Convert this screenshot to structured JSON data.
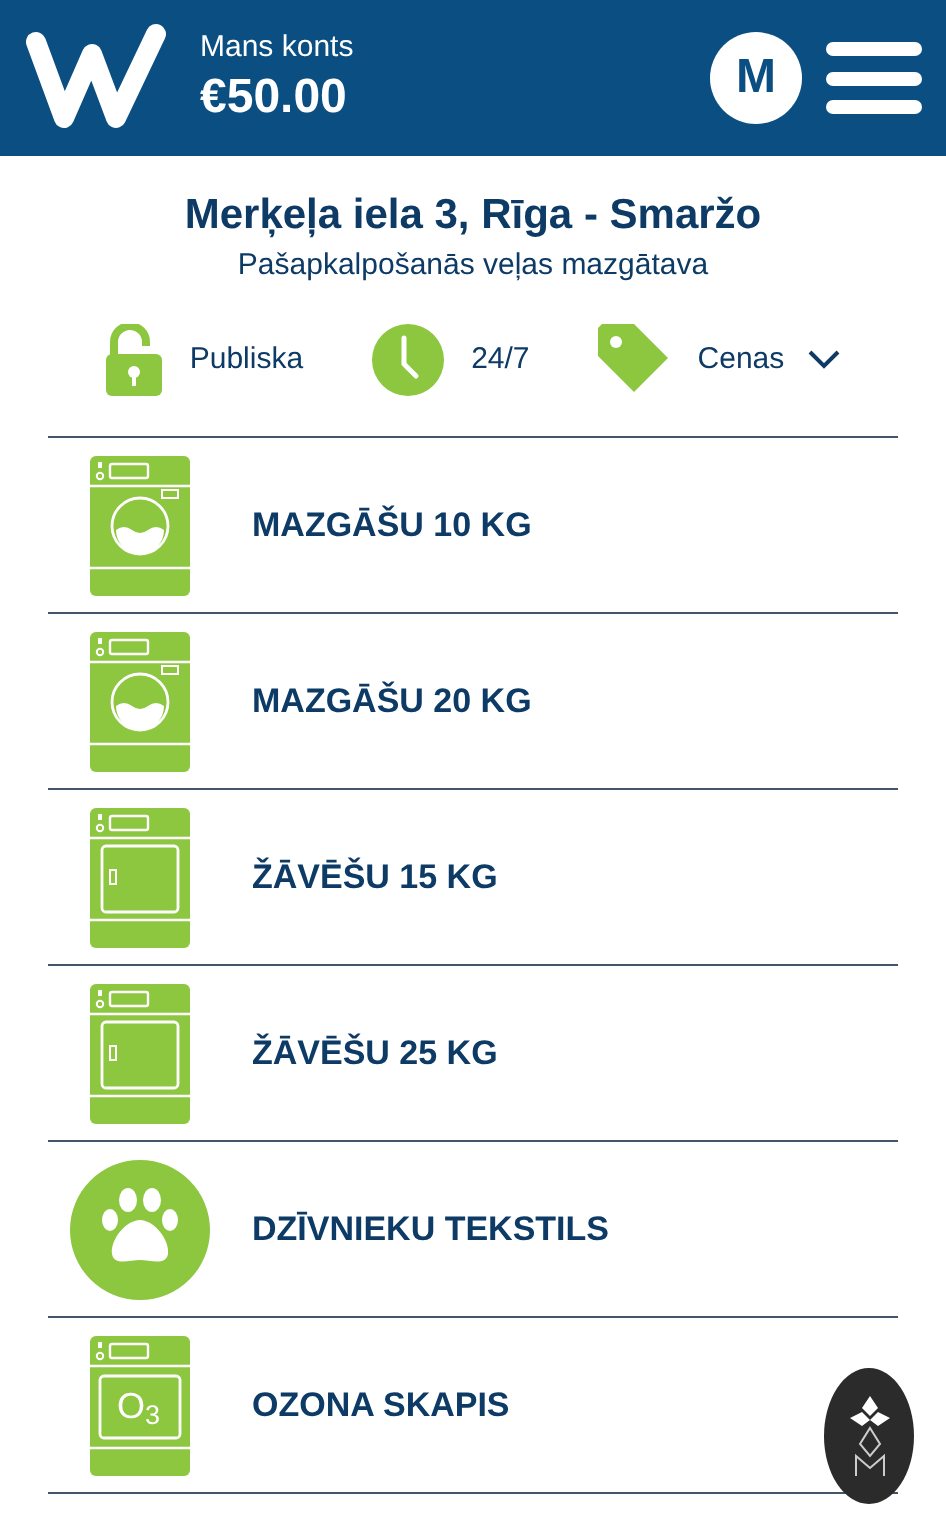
{
  "header": {
    "account_label": "Mans konts",
    "balance": "€50.00",
    "avatar_letter": "M"
  },
  "location": {
    "title": "Merķeļa iela 3, Rīga - Smaržo",
    "subtitle": "Pašapkalpošanās veļas mazgātava"
  },
  "info": [
    {
      "kind": "lock",
      "label": "Publiska"
    },
    {
      "kind": "clock",
      "label": "24/7"
    },
    {
      "kind": "tag",
      "label": "Cenas",
      "expanded": false
    }
  ],
  "services": [
    {
      "kind": "washer",
      "label": "MAZGĀŠU 10 KG"
    },
    {
      "kind": "washer",
      "label": "MAZGĀŠU 20 KG"
    },
    {
      "kind": "dryer",
      "label": "ŽĀVĒŠU 15 KG"
    },
    {
      "kind": "dryer",
      "label": "ŽĀVĒŠU 25 KG"
    },
    {
      "kind": "pet",
      "label": "DZĪVNIEKU TEKSTILS"
    },
    {
      "kind": "ozone",
      "label": "OZONA SKAPIS",
      "icon_text": "O$_{3}$"
    }
  ]
}
